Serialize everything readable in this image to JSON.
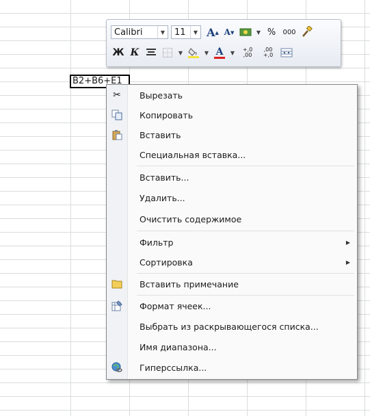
{
  "cell": {
    "formula_text": "B2+B6+E1"
  },
  "toolbar": {
    "font_name": "Calibri",
    "font_size": "11",
    "grow_label": "A",
    "shrink_label": "A",
    "percent": "%",
    "thousands": "000",
    "bold": "Ж",
    "italic": "К",
    "increase_decimal": "+,0 ,00",
    "decrease_decimal": ",00 +,0",
    "font_color_label": "A",
    "accent_fill": "#f5e23a",
    "accent_font": "#d9211e"
  },
  "menu": {
    "cut": "Вырезать",
    "copy": "Копировать",
    "paste": "Вставить",
    "paste_special": "Специальная вставка...",
    "insert": "Вставить...",
    "delete": "Удалить...",
    "clear_contents": "Очистить содержимое",
    "filter": "Фильтр",
    "sort": "Сортировка",
    "insert_comment": "Вставить примечание",
    "format_cells": "Формат ячеек...",
    "pick_from_list": "Выбрать из раскрывающегося списка...",
    "range_name": "Имя диапазона...",
    "hyperlink": "Гиперссылка..."
  },
  "icons": {
    "cut": "scissors-icon",
    "copy": "copy-icon",
    "paste": "paste-icon",
    "comment": "comment-icon",
    "format": "format-cells-icon",
    "hyperlink": "hyperlink-icon"
  }
}
